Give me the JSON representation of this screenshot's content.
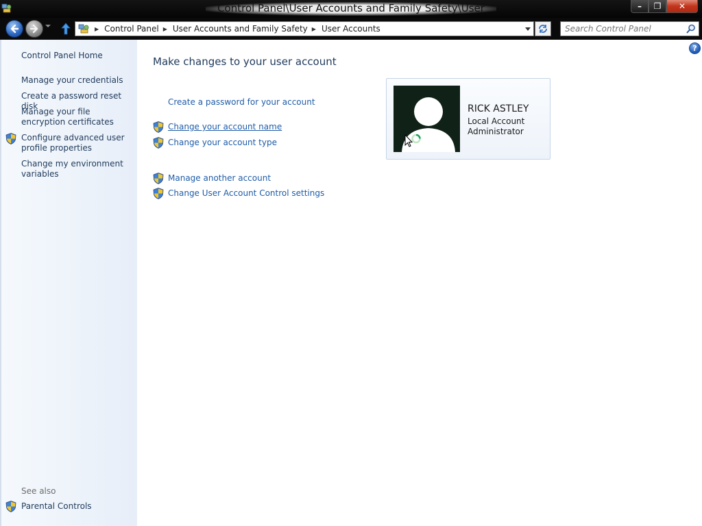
{
  "window": {
    "title": "Control Panel\\User Accounts and Family Safety\\User Accounts",
    "buttons": [
      "minimize",
      "restore",
      "close"
    ]
  },
  "nav": {
    "breadcrumbs": [
      "Control Panel",
      "User Accounts and Family Safety",
      "User Accounts"
    ],
    "search_placeholder": "Search Control Panel"
  },
  "sidebar": {
    "home": "Control Panel Home",
    "tasks": [
      {
        "label": "Manage your credentials",
        "shield": false
      },
      {
        "label": "Create a password reset disk",
        "shield": false
      },
      {
        "label": "Manage your file encryption certificates",
        "shield": false
      },
      {
        "label": "Configure advanced user profile properties",
        "shield": true
      },
      {
        "label": "Change my environment variables",
        "shield": false
      }
    ],
    "see_also_label": "See also",
    "see_also": [
      {
        "label": "Parental Controls",
        "shield": true
      }
    ]
  },
  "main": {
    "title": "Make changes to your user account",
    "links": [
      {
        "label": "Create a password for your account",
        "shield": false
      },
      {
        "label": "Change your account name",
        "shield": true,
        "hovered": true
      },
      {
        "label": "Change your account type",
        "shield": true
      },
      {
        "label": "Manage another account",
        "shield": true
      },
      {
        "label": "Change User Account Control settings",
        "shield": true
      }
    ]
  },
  "account": {
    "name": "RICK ASTLEY",
    "type": "Local Account",
    "role": "Administrator"
  },
  "colors": {
    "link": "#1e5ca8",
    "heading": "#1e395b",
    "sidebar_bg": "#e7eef8"
  }
}
